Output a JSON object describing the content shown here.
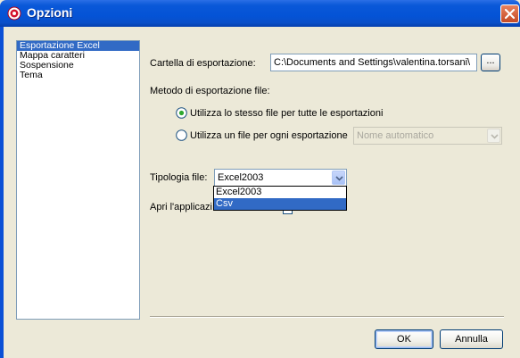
{
  "window": {
    "title": "Opzioni"
  },
  "nav": {
    "items": [
      "Esportazione Excel",
      "Mappa caratteri",
      "Sospensione",
      "Tema"
    ],
    "selected_index": 0
  },
  "export": {
    "folder_label": "Cartella di esportazione:",
    "folder_value": "C:\\Documents and Settings\\valentina.torsani\\",
    "browse_label": "...",
    "method_label": "Metodo di esportazione file:",
    "radio_same_file": "Utilizza lo stesso file per tutte le esportazioni",
    "radio_one_file": "Utilizza un file per ogni esportazione",
    "naming_value": "Nome automatico",
    "file_type_label": "Tipologia file:",
    "file_type_value": "Excel2003",
    "file_type_options": [
      "Excel2003",
      "Csv"
    ],
    "highlighted_option": "Csv",
    "open_app_label": "Apri l'applicazi"
  },
  "buttons": {
    "ok": "OK",
    "cancel": "Annulla"
  },
  "colors": {
    "title_bar": "#0453d6",
    "selection": "#316ac5",
    "dialog_bg": "#ece9d8"
  }
}
